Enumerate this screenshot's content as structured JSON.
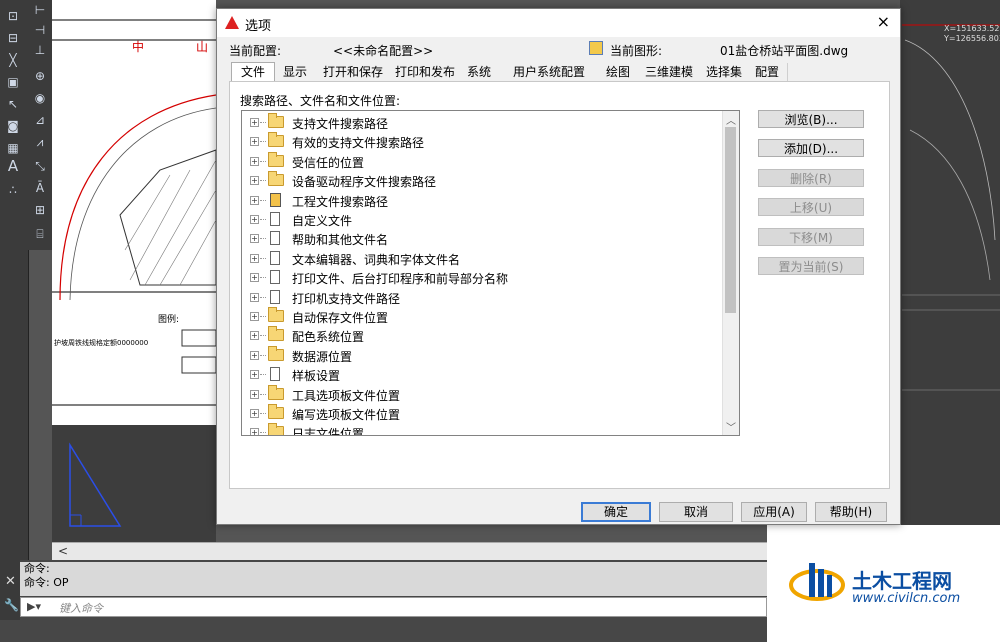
{
  "background": {
    "cad_labels": [
      "中",
      "山",
      "图例:",
      "护坡周铁线规格定额0000000"
    ],
    "coords": [
      "X=151633.522",
      "Y=126556.803"
    ]
  },
  "dialog": {
    "title": "选项",
    "close_label": "×",
    "profile_label": "当前配置:",
    "profile_value": "<<未命名配置>>",
    "drawing_label": "当前图形:",
    "drawing_value": "01盐仓桥站平面图.dwg",
    "tabs": [
      "文件",
      "显示",
      "打开和保存",
      "打印和发布",
      "系统",
      "用户系统配置",
      "绘图",
      "三维建模",
      "选择集",
      "配置"
    ],
    "active_tab": "文件",
    "panel_heading": "搜索路径、文件名和文件位置:",
    "tree_items": [
      {
        "label": "支持文件搜索路径",
        "icon": "folder-icon"
      },
      {
        "label": "有效的支持文件搜索路径",
        "icon": "folder-icon"
      },
      {
        "label": "受信任的位置",
        "icon": "folder-icon"
      },
      {
        "label": "设备驱动程序文件搜索路径",
        "icon": "folder-icon"
      },
      {
        "label": "工程文件搜索路径",
        "icon": "project-icon"
      },
      {
        "label": "自定义文件",
        "icon": "file-icon"
      },
      {
        "label": "帮助和其他文件名",
        "icon": "file-icon"
      },
      {
        "label": "文本编辑器、词典和字体文件名",
        "icon": "file-icon"
      },
      {
        "label": "打印文件、后台打印程序和前导部分名称",
        "icon": "file-icon"
      },
      {
        "label": "打印机支持文件路径",
        "icon": "file-icon"
      },
      {
        "label": "自动保存文件位置",
        "icon": "folder-icon"
      },
      {
        "label": "配色系统位置",
        "icon": "folder-icon"
      },
      {
        "label": "数据源位置",
        "icon": "folder-icon"
      },
      {
        "label": "样板设置",
        "icon": "file-icon"
      },
      {
        "label": "工具选项板文件位置",
        "icon": "folder-icon"
      },
      {
        "label": "编写选项板文件位置",
        "icon": "folder-icon"
      },
      {
        "label": "日志文件位置",
        "icon": "folder-icon"
      }
    ],
    "side_buttons": [
      {
        "label": "浏览(B)...",
        "enabled": true
      },
      {
        "label": "添加(D)...",
        "enabled": true
      },
      {
        "label": "删除(R)",
        "enabled": false
      },
      {
        "label": "上移(U)",
        "enabled": false
      },
      {
        "label": "下移(M)",
        "enabled": false
      },
      {
        "label": "置为当前(S)",
        "enabled": false
      }
    ],
    "ok_label": "确定",
    "cancel_label": "取消",
    "apply_label": "应用(A)",
    "help_label": "帮助(H)"
  },
  "command": {
    "history": [
      "命令:",
      "命令: OP"
    ],
    "placeholder": "键入命令"
  },
  "watermark": {
    "title": "土木工程网",
    "url": "www.civilcn.com"
  },
  "colors": {
    "accent": "#3a7bd5",
    "cad_red": "#d40000",
    "folder": "#f7d675"
  }
}
